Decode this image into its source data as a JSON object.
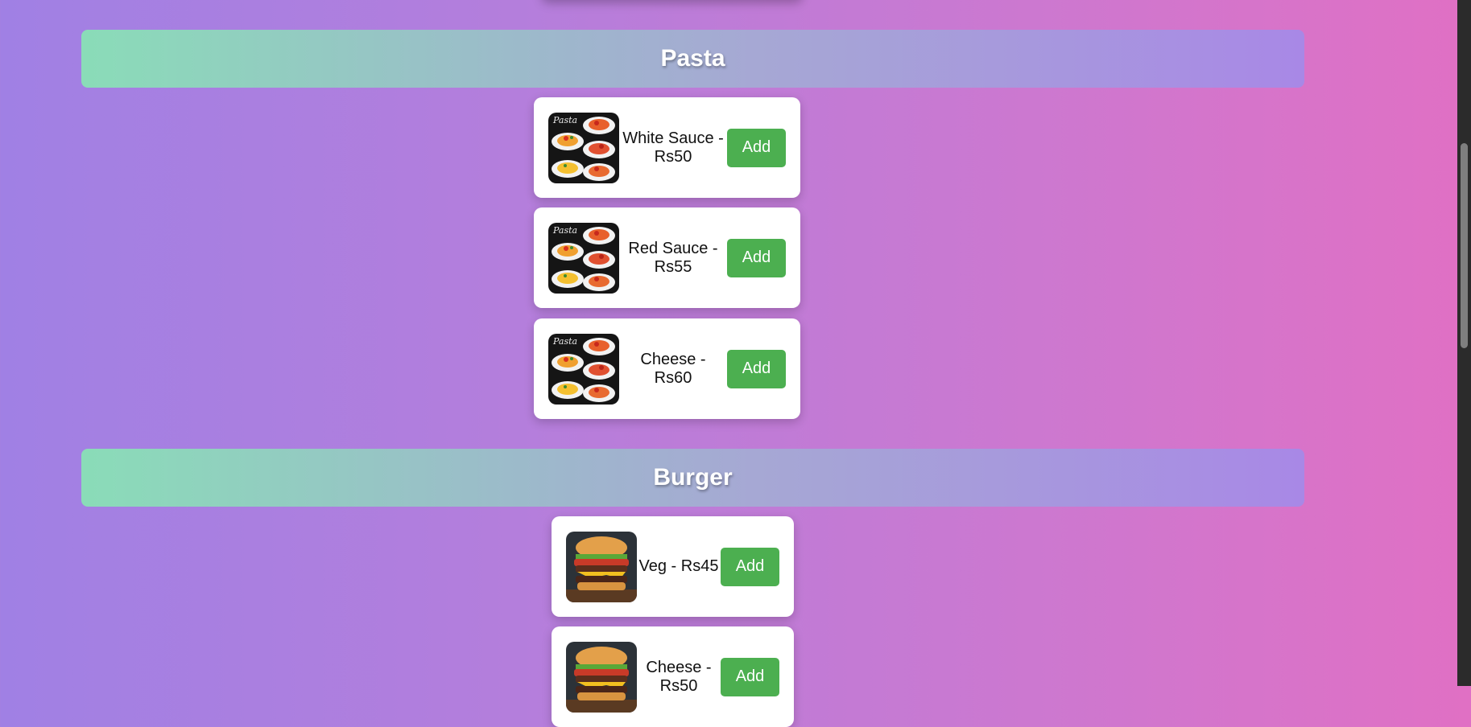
{
  "categories": [
    {
      "title": "Pasta",
      "items": [
        {
          "name": "White Sauce",
          "price": "Rs50",
          "label": "White Sauce - Rs50",
          "button": "Add",
          "icon": "pasta-image"
        },
        {
          "name": "Red Sauce",
          "price": "Rs55",
          "label": "Red Sauce - Rs55",
          "button": "Add",
          "icon": "pasta-image"
        },
        {
          "name": "Cheese",
          "price": "Rs60",
          "label": "Cheese - Rs60",
          "button": "Add",
          "icon": "pasta-image"
        }
      ]
    },
    {
      "title": "Burger",
      "items": [
        {
          "name": "Veg",
          "price": "Rs45",
          "label": "Veg - Rs45",
          "button": "Add",
          "icon": "burger-image"
        },
        {
          "name": "Cheese",
          "price": "Rs50",
          "label": "Cheese - Rs50",
          "button": "Add",
          "icon": "burger-image"
        }
      ]
    }
  ],
  "colors": {
    "add_button": "#4caf50",
    "card": "#ffffff",
    "header_gradient_start": "#8adcb8",
    "header_gradient_end": "#a888e6"
  }
}
